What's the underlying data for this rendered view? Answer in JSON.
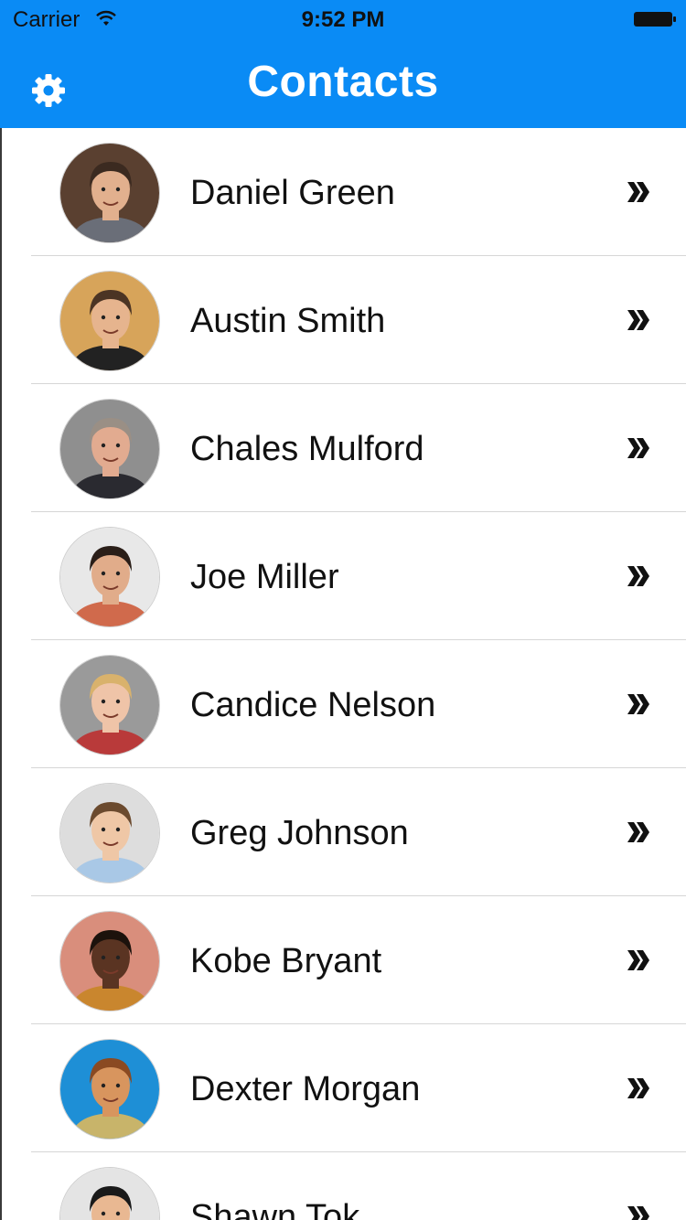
{
  "status_bar": {
    "carrier": "Carrier",
    "time": "9:52 PM"
  },
  "nav": {
    "title": "Contacts",
    "settings_icon": "gear-icon"
  },
  "contacts": [
    {
      "name": "Daniel Green",
      "bg": "#5a4030",
      "skin": "#e2b08e",
      "hair": "#3b2a20",
      "shirt": "#6a6e78"
    },
    {
      "name": "Austin Smith",
      "bg": "#d7a45a",
      "skin": "#e6b48e",
      "hair": "#4b3424",
      "shirt": "#222222"
    },
    {
      "name": "Chales Mulford",
      "bg": "#8f8f8f",
      "skin": "#e2ab90",
      "hair": "#9a8f85",
      "shirt": "#2a2a30"
    },
    {
      "name": "Joe Miller",
      "bg": "#e8e8e8",
      "skin": "#e1ac8a",
      "hair": "#2a1e18",
      "shirt": "#d06a4c"
    },
    {
      "name": "Candice Nelson",
      "bg": "#9a9a9a",
      "skin": "#efc4a8",
      "hair": "#d9b26c",
      "shirt": "#b93a3a"
    },
    {
      "name": "Greg Johnson",
      "bg": "#dddddd",
      "skin": "#efc7a6",
      "hair": "#6b4a2e",
      "shirt": "#a9c8e6"
    },
    {
      "name": "Kobe Bryant",
      "bg": "#d98e7c",
      "skin": "#5a3422",
      "hair": "#1c120c",
      "shirt": "#c9862e"
    },
    {
      "name": "Dexter Morgan",
      "bg": "#1e8fd6",
      "skin": "#d8955e",
      "hair": "#8a4a22",
      "shirt": "#c8b46a"
    },
    {
      "name": "Shawn Tok",
      "bg": "#e4e4e4",
      "skin": "#e9b892",
      "hair": "#1a1a1a",
      "shirt": "#333333"
    }
  ],
  "row_icon": "double-chevron-right-icon"
}
